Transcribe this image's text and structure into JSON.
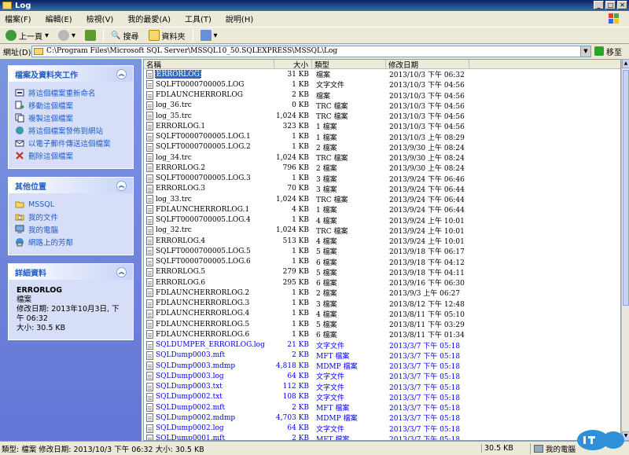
{
  "window": {
    "title": "Log"
  },
  "menu": [
    "檔案(F)",
    "編輯(E)",
    "檢視(V)",
    "我的最愛(A)",
    "工具(T)",
    "說明(H)"
  ],
  "toolbar": {
    "back": "上一頁",
    "search": "搜尋",
    "folders": "資料夾"
  },
  "address": {
    "label": "網址(D)",
    "path": "C:\\Program Files\\Microsoft SQL Server\\MSSQL10_50.SQLEXPRESS\\MSSQL\\Log",
    "go": "移至"
  },
  "tasks": {
    "title": "檔案及資料夾工作",
    "items": [
      "將這個檔案重新命名",
      "移動這個檔案",
      "複製這個檔案",
      "將這個檔案發佈到網站",
      "以電子郵件傳送這個檔案",
      "刪除這個檔案"
    ]
  },
  "places": {
    "title": "其他位置",
    "items": [
      "MSSQL",
      "我的文件",
      "我的電腦",
      "網路上的芳鄰"
    ]
  },
  "details": {
    "title": "詳細資料",
    "name": "ERRORLOG",
    "type": "檔案",
    "modified_label": "修改日期: 2013年10月3日, 下午 06:32",
    "size_label": "大小: 30.5 KB"
  },
  "columns": {
    "name": "名稱",
    "size": "大小",
    "type": "類型",
    "date": "修改日期"
  },
  "files": [
    [
      "ERRORLOG",
      "31 KB",
      "檔案",
      "2013/10/3 下午 06:32",
      "sel"
    ],
    [
      "SQLFT0000700005.LOG",
      "1 KB",
      "文字文件",
      "2013/10/3 下午 04:56",
      ""
    ],
    [
      "FDLAUNCHERRORLOG",
      "2 KB",
      "檔案",
      "2013/10/3 下午 04:56",
      ""
    ],
    [
      "log_36.trc",
      "0 KB",
      "TRC 檔案",
      "2013/10/3 下午 04:56",
      ""
    ],
    [
      "log_35.trc",
      "1,024 KB",
      "TRC 檔案",
      "2013/10/3 下午 04:56",
      ""
    ],
    [
      "ERRORLOG.1",
      "323 KB",
      "1 檔案",
      "2013/10/3 下午 04:56",
      ""
    ],
    [
      "SQLFT0000700005.LOG.1",
      "1 KB",
      "1 檔案",
      "2013/10/3 上午 08:29",
      ""
    ],
    [
      "SQLFT0000700005.LOG.2",
      "1 KB",
      "2 檔案",
      "2013/9/30 上午 08:24",
      ""
    ],
    [
      "log_34.trc",
      "1,024 KB",
      "TRC 檔案",
      "2013/9/30 上午 08:24",
      ""
    ],
    [
      "ERRORLOG.2",
      "796 KB",
      "2 檔案",
      "2013/9/30 上午 08:24",
      ""
    ],
    [
      "SQLFT0000700005.LOG.3",
      "1 KB",
      "3 檔案",
      "2013/9/24 下午 06:46",
      ""
    ],
    [
      "ERRORLOG.3",
      "70 KB",
      "3 檔案",
      "2013/9/24 下午 06:44",
      ""
    ],
    [
      "log_33.trc",
      "1,024 KB",
      "TRC 檔案",
      "2013/9/24 下午 06:44",
      ""
    ],
    [
      "FDLAUNCHERRORLOG.1",
      "4 KB",
      "1 檔案",
      "2013/9/24 下午 06:44",
      ""
    ],
    [
      "SQLFT0000700005.LOG.4",
      "1 KB",
      "4 檔案",
      "2013/9/24 上午 10:01",
      ""
    ],
    [
      "log_32.trc",
      "1,024 KB",
      "TRC 檔案",
      "2013/9/24 上午 10:01",
      ""
    ],
    [
      "ERRORLOG.4",
      "513 KB",
      "4 檔案",
      "2013/9/24 上午 10:01",
      ""
    ],
    [
      "SQLFT0000700005.LOG.5",
      "1 KB",
      "5 檔案",
      "2013/9/18 下午 06:17",
      ""
    ],
    [
      "SQLFT0000700005.LOG.6",
      "1 KB",
      "6 檔案",
      "2013/9/18 下午 04:12",
      ""
    ],
    [
      "ERRORLOG.5",
      "279 KB",
      "5 檔案",
      "2013/9/18 下午 04:11",
      ""
    ],
    [
      "ERRORLOG.6",
      "295 KB",
      "6 檔案",
      "2013/9/16 下午 06:30",
      ""
    ],
    [
      "FDLAUNCHERRORLOG.2",
      "1 KB",
      "2 檔案",
      "2013/9/3 上午 06:27",
      ""
    ],
    [
      "FDLAUNCHERRORLOG.3",
      "1 KB",
      "3 檔案",
      "2013/8/12 下午 12:48",
      ""
    ],
    [
      "FDLAUNCHERRORLOG.4",
      "1 KB",
      "4 檔案",
      "2013/8/11 下午 05:10",
      ""
    ],
    [
      "FDLAUNCHERRORLOG.5",
      "1 KB",
      "5 檔案",
      "2013/8/11 下午 03:29",
      ""
    ],
    [
      "FDLAUNCHERRORLOG.6",
      "1 KB",
      "6 檔案",
      "2013/8/11 下午 01:34",
      ""
    ],
    [
      "SQLDUMPER_ERRORLOG.log",
      "21 KB",
      "文字文件",
      "2013/3/7 下午 05:18",
      "blue"
    ],
    [
      "SQLDump0003.mft",
      "2 KB",
      "MFT 檔案",
      "2013/3/7 下午 05:18",
      "blue"
    ],
    [
      "SQLDump0003.mdmp",
      "4,818 KB",
      "MDMP 檔案",
      "2013/3/7 下午 05:18",
      "blue"
    ],
    [
      "SQLDump0003.log",
      "64 KB",
      "文字文件",
      "2013/3/7 下午 05:18",
      "blue"
    ],
    [
      "SQLDump0003.txt",
      "112 KB",
      "文字文件",
      "2013/3/7 下午 05:18",
      "blue"
    ],
    [
      "SQLDump0002.txt",
      "108 KB",
      "文字文件",
      "2013/3/7 下午 05:18",
      "blue"
    ],
    [
      "SQLDump0002.mft",
      "2 KB",
      "MFT 檔案",
      "2013/3/7 下午 05:18",
      "blue"
    ],
    [
      "SQLDump0002.mdmp",
      "4,703 KB",
      "MDMP 檔案",
      "2013/3/7 下午 05:18",
      "blue"
    ],
    [
      "SQLDump0002.log",
      "64 KB",
      "文字文件",
      "2013/3/7 下午 05:18",
      "blue"
    ],
    [
      "SQLDump0001.mft",
      "2 KB",
      "MFT 檔案",
      "2013/3/7 下午 05:18",
      "blue"
    ]
  ],
  "status": {
    "text": "類型: 檔案 修改日期: 2013/10/3 下午 06:32 大小: 30.5 KB",
    "size": "30.5 KB",
    "zone": "我的電腦"
  },
  "colors": {
    "titlebar": "#0a246a",
    "panel_link": "#215dc6",
    "compressed_blue": "#0000ee",
    "selection": "#316ac5"
  }
}
